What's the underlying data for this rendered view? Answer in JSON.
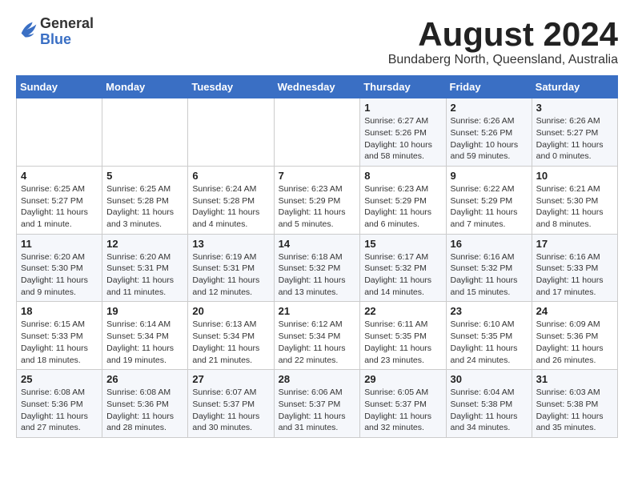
{
  "logo": {
    "general": "General",
    "blue": "Blue"
  },
  "title": "August 2024",
  "location": "Bundaberg North, Queensland, Australia",
  "days_of_week": [
    "Sunday",
    "Monday",
    "Tuesday",
    "Wednesday",
    "Thursday",
    "Friday",
    "Saturday"
  ],
  "weeks": [
    [
      {
        "day": "",
        "info": ""
      },
      {
        "day": "",
        "info": ""
      },
      {
        "day": "",
        "info": ""
      },
      {
        "day": "",
        "info": ""
      },
      {
        "day": "1",
        "info": "Sunrise: 6:27 AM\nSunset: 5:26 PM\nDaylight: 10 hours and 58 minutes."
      },
      {
        "day": "2",
        "info": "Sunrise: 6:26 AM\nSunset: 5:26 PM\nDaylight: 10 hours and 59 minutes."
      },
      {
        "day": "3",
        "info": "Sunrise: 6:26 AM\nSunset: 5:27 PM\nDaylight: 11 hours and 0 minutes."
      }
    ],
    [
      {
        "day": "4",
        "info": "Sunrise: 6:25 AM\nSunset: 5:27 PM\nDaylight: 11 hours and 1 minute."
      },
      {
        "day": "5",
        "info": "Sunrise: 6:25 AM\nSunset: 5:28 PM\nDaylight: 11 hours and 3 minutes."
      },
      {
        "day": "6",
        "info": "Sunrise: 6:24 AM\nSunset: 5:28 PM\nDaylight: 11 hours and 4 minutes."
      },
      {
        "day": "7",
        "info": "Sunrise: 6:23 AM\nSunset: 5:29 PM\nDaylight: 11 hours and 5 minutes."
      },
      {
        "day": "8",
        "info": "Sunrise: 6:23 AM\nSunset: 5:29 PM\nDaylight: 11 hours and 6 minutes."
      },
      {
        "day": "9",
        "info": "Sunrise: 6:22 AM\nSunset: 5:29 PM\nDaylight: 11 hours and 7 minutes."
      },
      {
        "day": "10",
        "info": "Sunrise: 6:21 AM\nSunset: 5:30 PM\nDaylight: 11 hours and 8 minutes."
      }
    ],
    [
      {
        "day": "11",
        "info": "Sunrise: 6:20 AM\nSunset: 5:30 PM\nDaylight: 11 hours and 9 minutes."
      },
      {
        "day": "12",
        "info": "Sunrise: 6:20 AM\nSunset: 5:31 PM\nDaylight: 11 hours and 11 minutes."
      },
      {
        "day": "13",
        "info": "Sunrise: 6:19 AM\nSunset: 5:31 PM\nDaylight: 11 hours and 12 minutes."
      },
      {
        "day": "14",
        "info": "Sunrise: 6:18 AM\nSunset: 5:32 PM\nDaylight: 11 hours and 13 minutes."
      },
      {
        "day": "15",
        "info": "Sunrise: 6:17 AM\nSunset: 5:32 PM\nDaylight: 11 hours and 14 minutes."
      },
      {
        "day": "16",
        "info": "Sunrise: 6:16 AM\nSunset: 5:32 PM\nDaylight: 11 hours and 15 minutes."
      },
      {
        "day": "17",
        "info": "Sunrise: 6:16 AM\nSunset: 5:33 PM\nDaylight: 11 hours and 17 minutes."
      }
    ],
    [
      {
        "day": "18",
        "info": "Sunrise: 6:15 AM\nSunset: 5:33 PM\nDaylight: 11 hours and 18 minutes."
      },
      {
        "day": "19",
        "info": "Sunrise: 6:14 AM\nSunset: 5:34 PM\nDaylight: 11 hours and 19 minutes."
      },
      {
        "day": "20",
        "info": "Sunrise: 6:13 AM\nSunset: 5:34 PM\nDaylight: 11 hours and 21 minutes."
      },
      {
        "day": "21",
        "info": "Sunrise: 6:12 AM\nSunset: 5:34 PM\nDaylight: 11 hours and 22 minutes."
      },
      {
        "day": "22",
        "info": "Sunrise: 6:11 AM\nSunset: 5:35 PM\nDaylight: 11 hours and 23 minutes."
      },
      {
        "day": "23",
        "info": "Sunrise: 6:10 AM\nSunset: 5:35 PM\nDaylight: 11 hours and 24 minutes."
      },
      {
        "day": "24",
        "info": "Sunrise: 6:09 AM\nSunset: 5:36 PM\nDaylight: 11 hours and 26 minutes."
      }
    ],
    [
      {
        "day": "25",
        "info": "Sunrise: 6:08 AM\nSunset: 5:36 PM\nDaylight: 11 hours and 27 minutes."
      },
      {
        "day": "26",
        "info": "Sunrise: 6:08 AM\nSunset: 5:36 PM\nDaylight: 11 hours and 28 minutes."
      },
      {
        "day": "27",
        "info": "Sunrise: 6:07 AM\nSunset: 5:37 PM\nDaylight: 11 hours and 30 minutes."
      },
      {
        "day": "28",
        "info": "Sunrise: 6:06 AM\nSunset: 5:37 PM\nDaylight: 11 hours and 31 minutes."
      },
      {
        "day": "29",
        "info": "Sunrise: 6:05 AM\nSunset: 5:37 PM\nDaylight: 11 hours and 32 minutes."
      },
      {
        "day": "30",
        "info": "Sunrise: 6:04 AM\nSunset: 5:38 PM\nDaylight: 11 hours and 34 minutes."
      },
      {
        "day": "31",
        "info": "Sunrise: 6:03 AM\nSunset: 5:38 PM\nDaylight: 11 hours and 35 minutes."
      }
    ]
  ]
}
